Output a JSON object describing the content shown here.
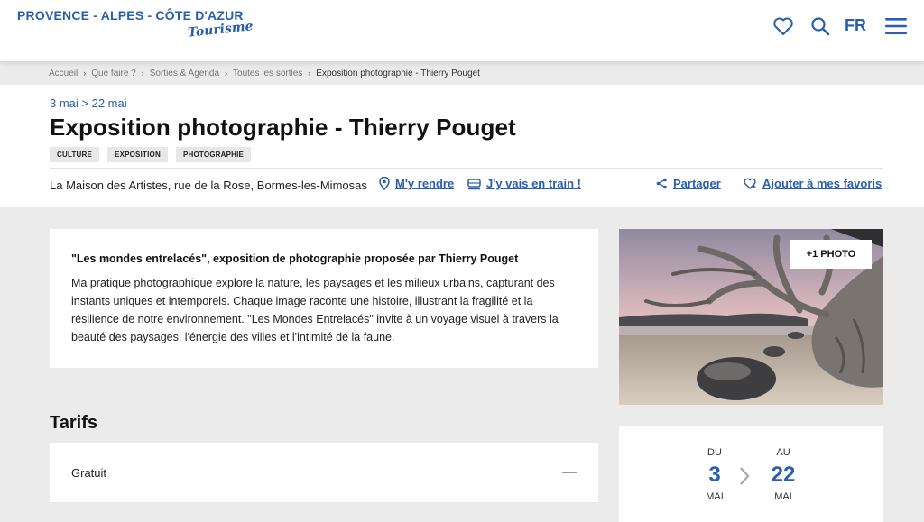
{
  "header": {
    "logo_main": "PROVENCE - ALPES - CÔTE D'AZUR",
    "logo_sub": "Tourisme",
    "icons": [
      "heart-icon",
      "search-icon",
      "menu-icon"
    ],
    "language": "FR"
  },
  "breadcrumb": {
    "items": [
      "Accueil",
      "Que faire ?",
      "Sorties & Agenda",
      "Toutes les sorties",
      "Exposition photographie - Thierry Pouget"
    ]
  },
  "event": {
    "dates": "3 mai > 22 mai",
    "title": "Exposition photographie - Thierry Pouget",
    "tags": [
      "CULTURE",
      "EXPOSITION",
      "PHOTOGRAPHIE"
    ],
    "address": "La Maison des Artistes, rue de la Rose, Bormes-les-Mimosas",
    "actions": {
      "directions": "M'y rendre",
      "train": "J'y vais en train !",
      "share": "Partager",
      "favorite": "Ajouter à mes favoris"
    }
  },
  "description": {
    "heading": "\"Les mondes entrelacés\", exposition de photographie proposée par Thierry Pouget",
    "body": "Ma pratique photographique explore la nature, les paysages et les milieux urbains, capturant des instants uniques et intemporels. Chaque image raconte une histoire, illustrant la fragilité et la résilience de notre environnement. \"Les Mondes Entrelacés\" invite à un voyage visuel à travers la beauté des paysages, l'énergie des villes et l'intimité de la faune."
  },
  "photo": {
    "more_label": "+1 PHOTO"
  },
  "tarifs": {
    "heading": "Tarifs",
    "items": [
      {
        "label": "Gratuit",
        "toggle": "—"
      }
    ]
  },
  "date_card": {
    "from_label": "DU",
    "from_day": "3",
    "from_month": "MAI",
    "to_label": "AU",
    "to_day": "22",
    "to_month": "MAI"
  },
  "colors": {
    "brand": "#2a5fad",
    "page_background": "#ebebeb",
    "card_background": "#ffffff",
    "tag_background": "#e8e8e8"
  }
}
